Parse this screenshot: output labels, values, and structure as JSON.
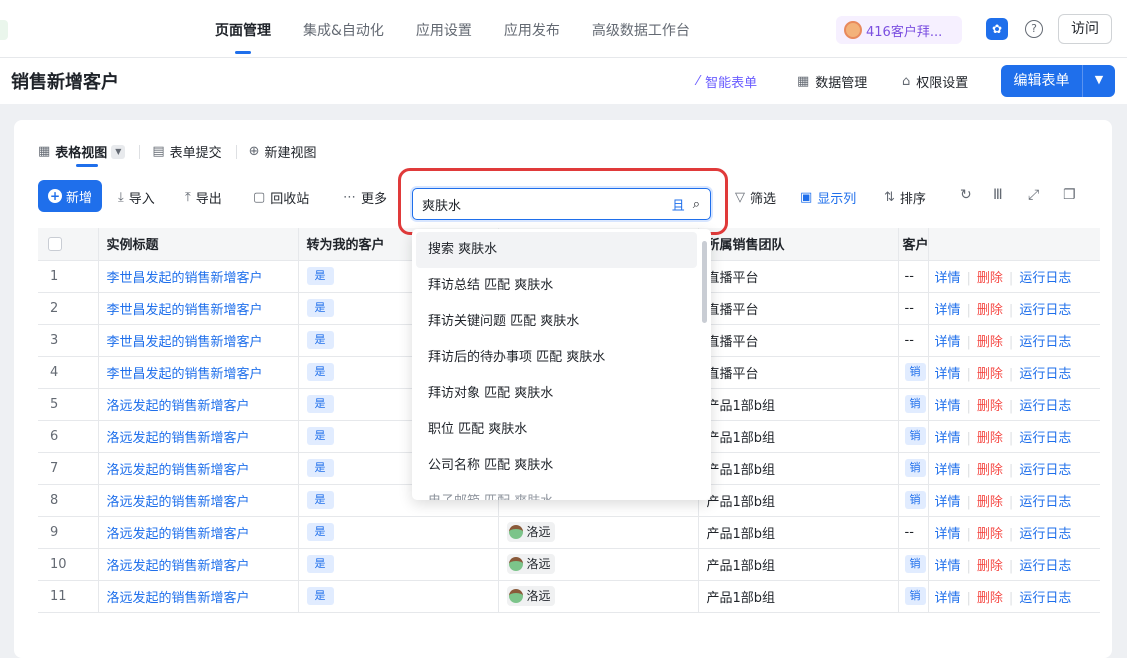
{
  "nav": {
    "tabs": [
      "页面管理",
      "集成&自动化",
      "应用设置",
      "应用发布",
      "高级数据工作台"
    ],
    "active_tab": 0,
    "notification_chip": "416客户拜...",
    "help_icon": "?",
    "visit_label": "访问"
  },
  "page": {
    "title": "销售新增客户",
    "actions": {
      "ai_form": "智能表单",
      "data_manage": "数据管理",
      "permission": "权限设置"
    },
    "edit_form": "编辑表单"
  },
  "views": {
    "table_view": "表格视图",
    "form_submit": "表单提交",
    "new_view": "新建视图"
  },
  "toolbar": {
    "add": "新增",
    "import": "导入",
    "export": "导出",
    "recycle": "回收站",
    "more": "更多",
    "filter": "筛选",
    "columns": "显示列",
    "sort": "排序"
  },
  "search": {
    "value": "爽肤水",
    "q_label": "且",
    "suggestions": [
      "搜索 爽肤水",
      "拜访总结 匹配 爽肤水",
      "拜访关键问题 匹配 爽肤水",
      "拜访后的待办事项 匹配 爽肤水",
      "拜访对象 匹配 爽肤水",
      "职位 匹配 爽肤水",
      "公司名称 匹配 爽肤水",
      "电子邮箱 匹配 爽肤水"
    ]
  },
  "table": {
    "headers": [
      "实例标题",
      "转为我的客户",
      "",
      "所属销售团队",
      "客户"
    ],
    "op_labels": [
      "详情",
      "删除",
      "运行日志"
    ],
    "rows": [
      {
        "idx": "1",
        "title": "李世昌发起的销售新增客户",
        "mine": "是",
        "owner": "",
        "team": "直播平台",
        "cust": "--"
      },
      {
        "idx": "2",
        "title": "李世昌发起的销售新增客户",
        "mine": "是",
        "owner": "",
        "team": "直播平台",
        "cust": "--"
      },
      {
        "idx": "3",
        "title": "李世昌发起的销售新增客户",
        "mine": "是",
        "owner": "",
        "team": "直播平台",
        "cust": "--"
      },
      {
        "idx": "4",
        "title": "李世昌发起的销售新增客户",
        "mine": "是",
        "owner": "",
        "team": "直播平台",
        "cust": "销"
      },
      {
        "idx": "5",
        "title": "洛远发起的销售新增客户",
        "mine": "是",
        "owner": "",
        "team": "产品1部b组",
        "cust": "销"
      },
      {
        "idx": "6",
        "title": "洛远发起的销售新增客户",
        "mine": "是",
        "owner": "",
        "team": "产品1部b组",
        "cust": "销"
      },
      {
        "idx": "7",
        "title": "洛远发起的销售新增客户",
        "mine": "是",
        "owner": "",
        "team": "产品1部b组",
        "cust": "销"
      },
      {
        "idx": "8",
        "title": "洛远发起的销售新增客户",
        "mine": "是",
        "owner": "",
        "team": "产品1部b组",
        "cust": "销"
      },
      {
        "idx": "9",
        "title": "洛远发起的销售新增客户",
        "mine": "是",
        "owner": "洛远",
        "team": "产品1部b组",
        "cust": "--"
      },
      {
        "idx": "10",
        "title": "洛远发起的销售新增客户",
        "mine": "是",
        "owner": "洛远",
        "team": "产品1部b组",
        "cust": "销"
      },
      {
        "idx": "11",
        "title": "洛远发起的销售新增客户",
        "mine": "是",
        "owner": "洛远",
        "team": "产品1部b组",
        "cust": "销"
      }
    ]
  }
}
